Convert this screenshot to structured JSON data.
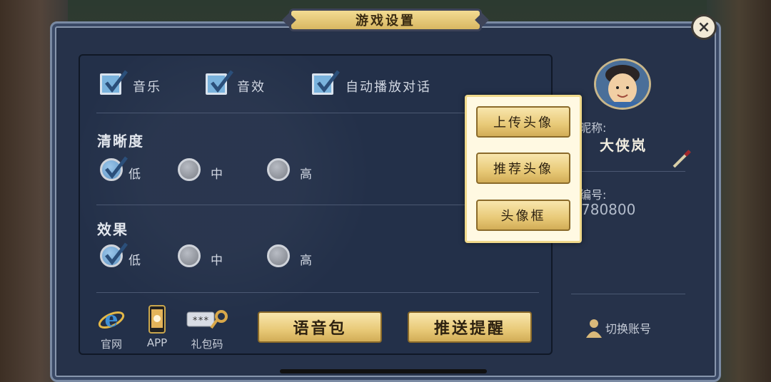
{
  "window": {
    "title": "游戏设置",
    "close_label": "×"
  },
  "toggles": [
    {
      "label": "音乐",
      "checked": true
    },
    {
      "label": "音效",
      "checked": true
    },
    {
      "label": "自动播放对话",
      "checked": true
    }
  ],
  "clarity": {
    "title": "清晰度",
    "options": [
      "低",
      "中",
      "高"
    ],
    "selected": "低"
  },
  "effects": {
    "title": "效果",
    "options": [
      "低",
      "中",
      "高"
    ],
    "selected": "低"
  },
  "links": [
    {
      "label": "官网",
      "icon": "ie-icon"
    },
    {
      "label": "APP",
      "icon": "phone-icon"
    },
    {
      "label": "礼包码",
      "icon": "key-icon"
    }
  ],
  "buttons": {
    "voice_pack": "语音包",
    "push_reminder": "推送提醒"
  },
  "popup": {
    "items": [
      "上传头像",
      "推荐头像",
      "头像框"
    ]
  },
  "profile": {
    "nickname_label": "昵称:",
    "nickname": "大侠岚",
    "id_label": "编号:",
    "id_value": "780800",
    "switch_account": "切换账号"
  },
  "colors": {
    "gold": "#e8c977",
    "panel": "#233049",
    "checkbox": "#7ab3dd"
  }
}
